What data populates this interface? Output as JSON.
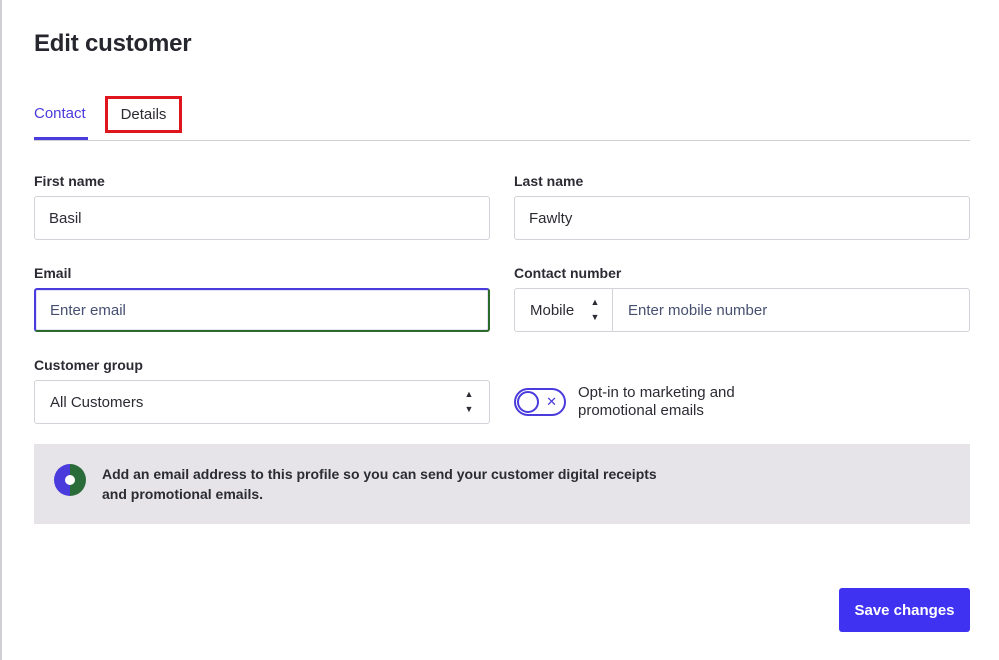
{
  "dialog": {
    "title": "Edit customer"
  },
  "tabs": [
    {
      "label": "Contact",
      "active": true
    },
    {
      "label": "Details",
      "active": false,
      "highlighted": true
    }
  ],
  "form": {
    "first_name": {
      "label": "First name",
      "value": "Basil"
    },
    "last_name": {
      "label": "Last name",
      "value": "Fawlty"
    },
    "email": {
      "label": "Email",
      "value": "",
      "placeholder": "Enter email"
    },
    "contact_number": {
      "label": "Contact number",
      "type_selected": "Mobile",
      "value": "",
      "placeholder": "Enter mobile number"
    },
    "customer_group": {
      "label": "Customer group",
      "selected": "All Customers"
    },
    "opt_in": {
      "label": "Opt-in to marketing and promotional emails",
      "enabled": false,
      "icon": "x-icon"
    }
  },
  "info": {
    "text": "Add an email address to this profile so you can send your customer digital receipts and promotional emails.",
    "icon": "info-circle-icon"
  },
  "actions": {
    "save_label": "Save changes"
  },
  "colors": {
    "accent": "#4a3bdc",
    "button": "#3f32f0",
    "tab_highlight": "#e0161e",
    "info_bg": "#e6e4e8"
  }
}
